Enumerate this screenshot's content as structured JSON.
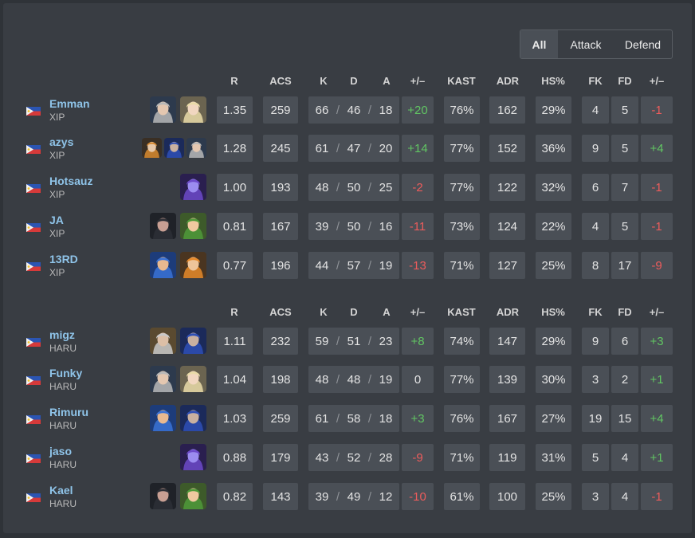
{
  "filters": [
    "All",
    "Attack",
    "Defend"
  ],
  "active_filter": "All",
  "columns": [
    "R",
    "ACS",
    "K",
    "D",
    "A",
    "+/–",
    "KAST",
    "ADR",
    "HS%",
    "FK",
    "FD",
    "+/–"
  ],
  "colors": {
    "positive": "#61c563",
    "negative": "#ed5c5c",
    "player_name": "#8fc4e9"
  },
  "teams": [
    {
      "players": [
        {
          "name": "Emman",
          "team": "XIP",
          "flag": "philippines-flag-icon",
          "agents": [
            "agent-gray-hair-icon",
            "agent-blonde-icon"
          ],
          "r": "1.35",
          "acs": "259",
          "k": "66",
          "d": "46",
          "a": "18",
          "pm": "+20",
          "kast": "76%",
          "adr": "162",
          "hs": "29%",
          "fk": "4",
          "fd": "5",
          "fkfd": "-1"
        },
        {
          "name": "azys",
          "team": "XIP",
          "flag": "philippines-flag-icon",
          "agents": [
            "agent-orange-hood-icon",
            "agent-blue-hair-icon",
            "agent-gray-hair-icon"
          ],
          "r": "1.28",
          "acs": "245",
          "k": "61",
          "d": "47",
          "a": "20",
          "pm": "+14",
          "kast": "77%",
          "adr": "152",
          "hs": "36%",
          "fk": "9",
          "fd": "5",
          "fkfd": "+4"
        },
        {
          "name": "Hotsauz",
          "team": "XIP",
          "flag": "philippines-flag-icon",
          "agents": [
            "agent-purple-hood-icon"
          ],
          "r": "1.00",
          "acs": "193",
          "k": "48",
          "d": "50",
          "a": "25",
          "pm": "-2",
          "kast": "77%",
          "adr": "122",
          "hs": "32%",
          "fk": "6",
          "fd": "7",
          "fkfd": "-1"
        },
        {
          "name": "JA",
          "team": "XIP",
          "flag": "philippines-flag-icon",
          "agents": [
            "agent-masked-icon",
            "agent-green-cap-icon"
          ],
          "r": "0.81",
          "acs": "167",
          "k": "39",
          "d": "50",
          "a": "16",
          "pm": "-11",
          "kast": "73%",
          "adr": "124",
          "hs": "22%",
          "fk": "4",
          "fd": "5",
          "fkfd": "-1"
        },
        {
          "name": "13RD",
          "team": "XIP",
          "flag": "philippines-flag-icon",
          "agents": [
            "agent-blue-spiky-icon",
            "agent-orange-goggles-icon"
          ],
          "r": "0.77",
          "acs": "196",
          "k": "44",
          "d": "57",
          "a": "19",
          "pm": "-13",
          "kast": "71%",
          "adr": "127",
          "hs": "25%",
          "fk": "8",
          "fd": "17",
          "fkfd": "-9"
        }
      ]
    },
    {
      "players": [
        {
          "name": "migz",
          "team": "HARU",
          "flag": "philippines-flag-icon",
          "agents": [
            "agent-silver-hair-icon",
            "agent-blue-hair-icon"
          ],
          "r": "1.11",
          "acs": "232",
          "k": "59",
          "d": "51",
          "a": "23",
          "pm": "+8",
          "kast": "74%",
          "adr": "147",
          "hs": "29%",
          "fk": "9",
          "fd": "6",
          "fkfd": "+3"
        },
        {
          "name": "Funky",
          "team": "HARU",
          "flag": "philippines-flag-icon",
          "agents": [
            "agent-gray-hair-icon",
            "agent-blonde-icon"
          ],
          "r": "1.04",
          "acs": "198",
          "k": "48",
          "d": "48",
          "a": "19",
          "pm": "0",
          "kast": "77%",
          "adr": "139",
          "hs": "30%",
          "fk": "3",
          "fd": "2",
          "fkfd": "+1"
        },
        {
          "name": "Rimuru",
          "team": "HARU",
          "flag": "philippines-flag-icon",
          "agents": [
            "agent-blue-spiky-icon",
            "agent-blue-hair-icon"
          ],
          "r": "1.03",
          "acs": "259",
          "k": "61",
          "d": "58",
          "a": "18",
          "pm": "+3",
          "kast": "76%",
          "adr": "167",
          "hs": "27%",
          "fk": "19",
          "fd": "15",
          "fkfd": "+4"
        },
        {
          "name": "jaso",
          "team": "HARU",
          "flag": "philippines-flag-icon",
          "agents": [
            "agent-purple-hood-icon"
          ],
          "r": "0.88",
          "acs": "179",
          "k": "43",
          "d": "52",
          "a": "28",
          "pm": "-9",
          "kast": "71%",
          "adr": "119",
          "hs": "31%",
          "fk": "5",
          "fd": "4",
          "fkfd": "+1"
        },
        {
          "name": "Kael",
          "team": "HARU",
          "flag": "philippines-flag-icon",
          "agents": [
            "agent-masked-icon",
            "agent-green-cap-icon"
          ],
          "r": "0.82",
          "acs": "143",
          "k": "39",
          "d": "49",
          "a": "12",
          "pm": "-10",
          "kast": "61%",
          "adr": "100",
          "hs": "25%",
          "fk": "3",
          "fd": "4",
          "fkfd": "-1"
        }
      ]
    }
  ]
}
